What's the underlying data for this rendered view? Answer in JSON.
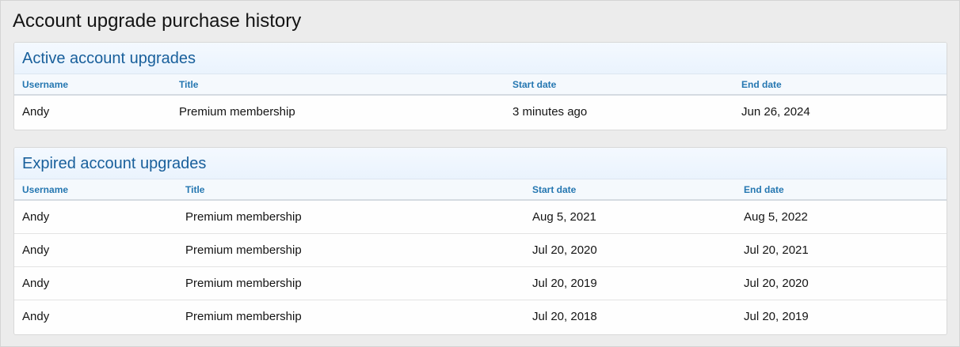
{
  "page": {
    "title": "Account upgrade purchase history"
  },
  "active": {
    "title": "Active account upgrades",
    "columns": [
      "Username",
      "Title",
      "Start date",
      "End date"
    ],
    "rows": [
      [
        "Andy",
        "Premium membership",
        "3 minutes ago",
        "Jun 26, 2024"
      ]
    ]
  },
  "expired": {
    "title": "Expired account upgrades",
    "columns": [
      "Username",
      "Title",
      "Start date",
      "End date"
    ],
    "rows": [
      [
        "Andy",
        "Premium membership",
        "Aug 5, 2021",
        "Aug 5, 2022"
      ],
      [
        "Andy",
        "Premium membership",
        "Jul 20, 2020",
        "Jul 20, 2021"
      ],
      [
        "Andy",
        "Premium membership",
        "Jul 20, 2019",
        "Jul 20, 2020"
      ],
      [
        "Andy",
        "Premium membership",
        "Jul 20, 2018",
        "Jul 20, 2019"
      ]
    ]
  },
  "colors": {
    "block_title": "#185f9b",
    "column_header": "#2577b1",
    "page_background": "#ececec"
  }
}
